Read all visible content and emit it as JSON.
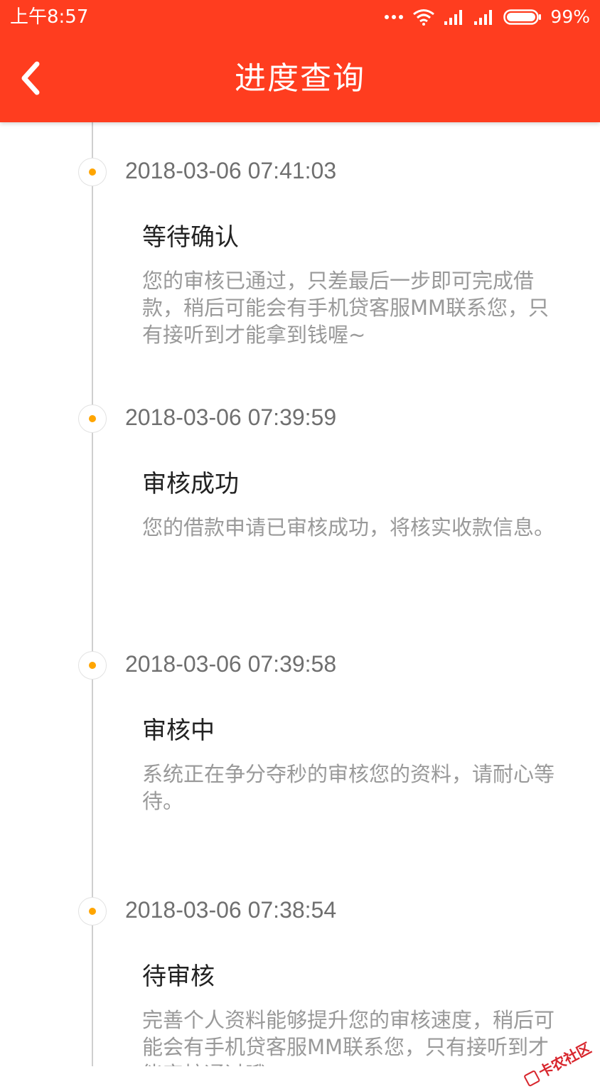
{
  "status_bar": {
    "time": "上午8:57",
    "battery": "99%",
    "icons": [
      "more-dots-icon",
      "wifi-icon",
      "signal-icon",
      "signal-icon",
      "battery-icon"
    ]
  },
  "nav": {
    "title": "进度查询",
    "back_icon": "chevron-left-icon"
  },
  "colors": {
    "header_bg": "#ff3d1f",
    "dot_accent": "#ffa500"
  },
  "timeline": [
    {
      "time": "2018-03-06 07:41:03",
      "title": "等待确认",
      "desc": "您的审核已通过，只差最后一步即可完成借款，稍后可能会有手机贷客服MM联系您，只有接听到才能拿到钱喔~"
    },
    {
      "time": "2018-03-06 07:39:59",
      "title": "审核成功",
      "desc": "您的借款申请已审核成功，将核实收款信息。"
    },
    {
      "time": "2018-03-06 07:39:58",
      "title": "审核中",
      "desc": "系统正在争分夺秒的审核您的资料，请耐心等待。"
    },
    {
      "time": "2018-03-06 07:38:54",
      "title": "待审核",
      "desc": "完善个人资料能够提升您的审核速度，稍后可能会有手机贷客服MM联系您，只有接听到才能审核通过哦。"
    }
  ],
  "watermark": "卡农社区"
}
